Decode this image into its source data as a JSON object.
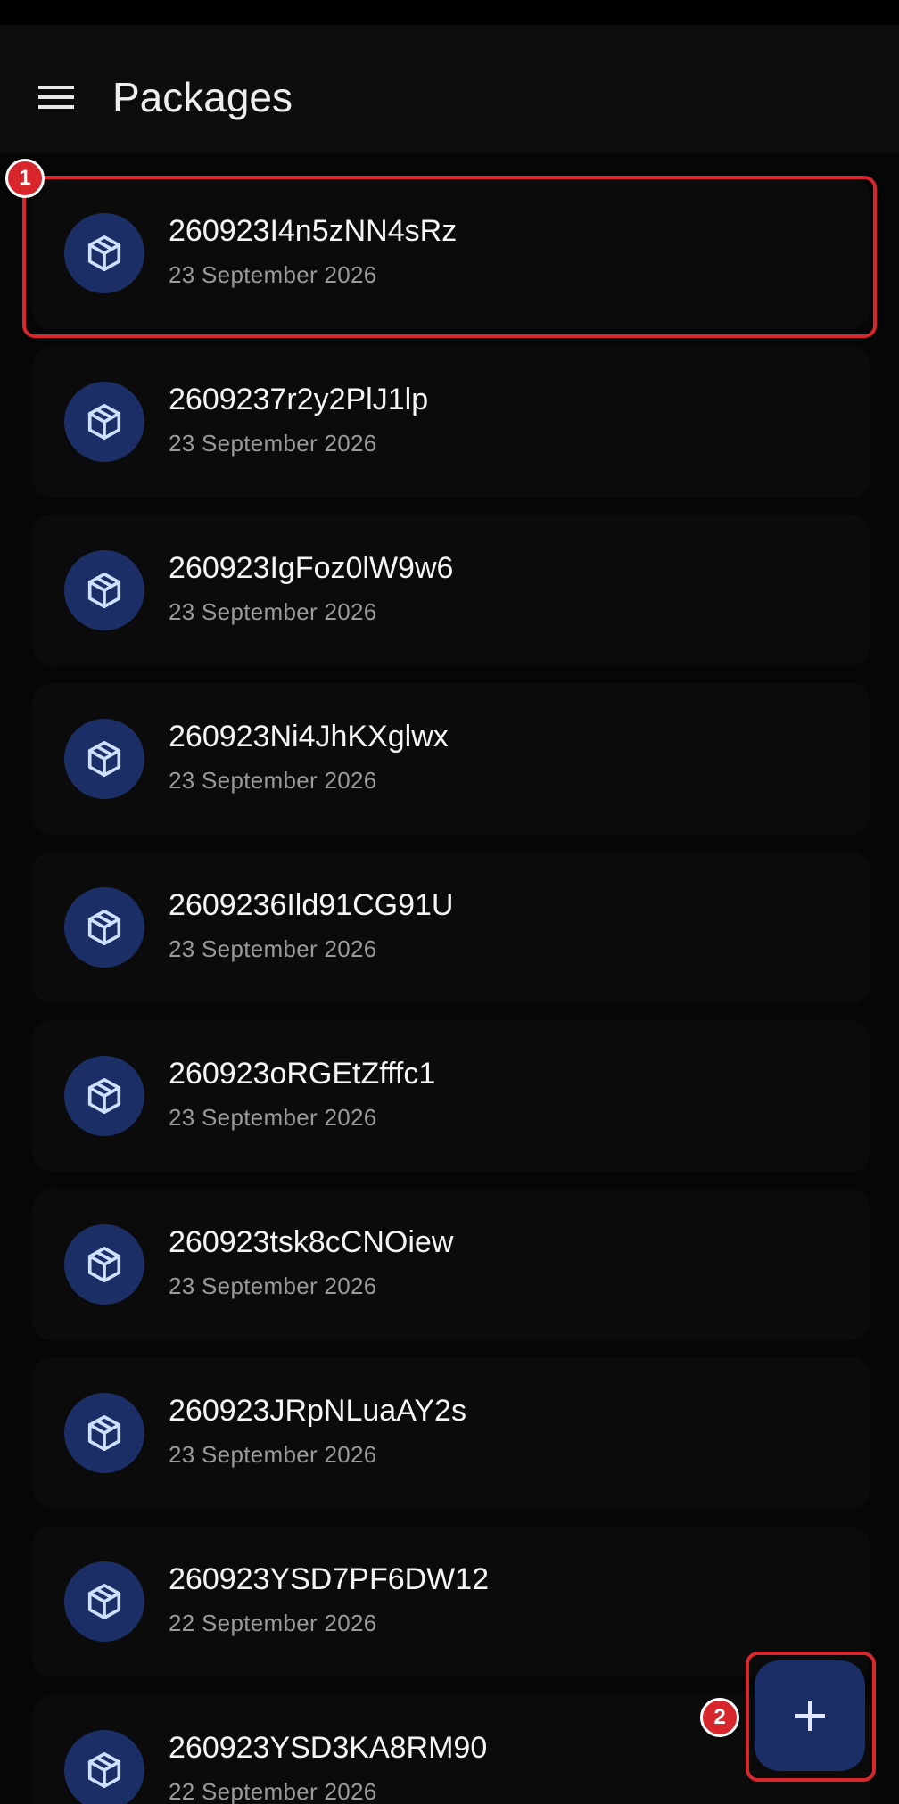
{
  "app_bar": {
    "title": "Packages",
    "menu_icon": "menu-icon"
  },
  "packages": [
    {
      "id": "260923I4n5zNN4sRz",
      "date": "23 September 2026"
    },
    {
      "id": "2609237r2y2PlJ1lp",
      "date": "23 September 2026"
    },
    {
      "id": "260923IgFoz0lW9w6",
      "date": "23 September 2026"
    },
    {
      "id": "260923Ni4JhKXglwx",
      "date": "23 September 2026"
    },
    {
      "id": "2609236Ild91CG91U",
      "date": "23 September 2026"
    },
    {
      "id": "260923oRGEtZfffc1",
      "date": "23 September 2026"
    },
    {
      "id": "260923tsk8cCNOiew",
      "date": "23 September 2026"
    },
    {
      "id": "260923JRpNLuaAY2s",
      "date": "23 September 2026"
    },
    {
      "id": "260923YSD7PF6DW12",
      "date": "22 September 2026"
    },
    {
      "id": "260923YSD3KA8RM90",
      "date": "22 September 2026"
    }
  ],
  "package_icon": "package-box-icon",
  "fab": {
    "icon": "plus-icon"
  },
  "annotations": {
    "badge_1": "1",
    "badge_2": "2"
  },
  "colors": {
    "background": "#060606",
    "app_bar": "#0d0d0d",
    "card": "#0b0b0b",
    "accent": "#1b2f66",
    "icon_stroke": "#cfe0ff",
    "highlight": "#d8262d"
  }
}
